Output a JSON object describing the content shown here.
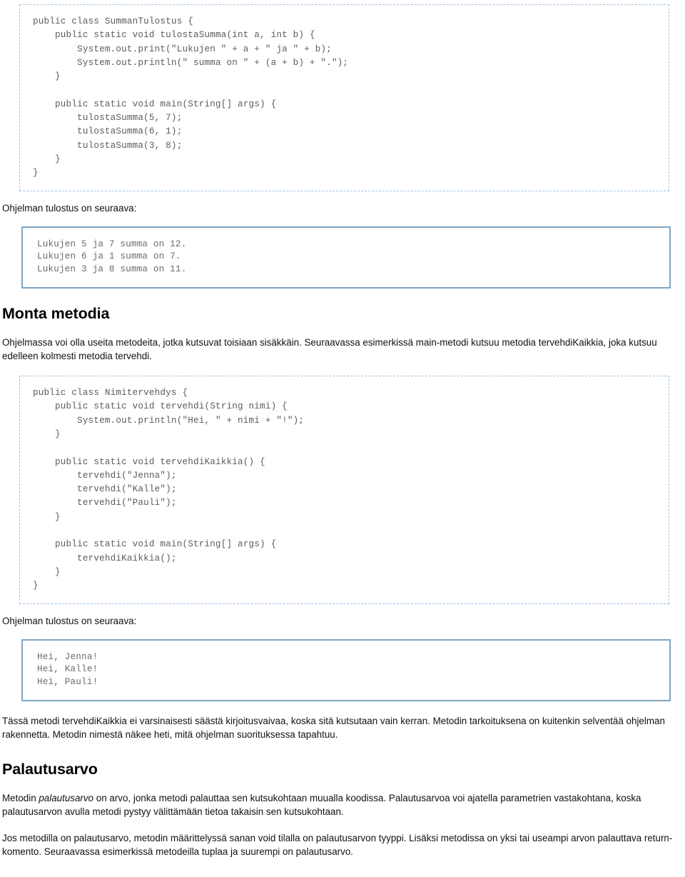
{
  "doc": {
    "language": "fi"
  },
  "blocks": {
    "code_summan_tulostus": {
      "lines": [
        "public class SummanTulostus {",
        "    public static void tulostaSumma(int a, int b) {",
        "        System.out.print(\"Lukujen \" + a + \" ja \" + b);",
        "        System.out.println(\" summa on \" + (a + b) + \".\");",
        "    }",
        "",
        "    public static void main(String[] args) {",
        "        tulostaSumma(5, 7);",
        "        tulostaSumma(6, 1);",
        "        tulostaSumma(3, 8);",
        "    }",
        "}"
      ]
    },
    "output_caption_1": "Ohjelman tulostus on seuraava:",
    "output_summan_tulostus": {
      "lines": [
        "Lukujen 5 ja 7 summa on 12.",
        "Lukujen 6 ja 1 summa on 7.",
        "Lukujen 3 ja 8 summa on 11."
      ]
    },
    "heading_monta_metodia": "Monta metodia",
    "para_monta_metodia": "Ohjelmassa voi olla useita metodeita, jotka kutsuvat toisiaan sisäkkäin. Seuraavassa esimerkissä main-metodi kutsuu metodia tervehdiKaikkia, joka kutsuu edelleen kolmesti metodia tervehdi.",
    "code_nimitervehdys": {
      "lines": [
        "public class Nimitervehdys {",
        "    public static void tervehdi(String nimi) {",
        "        System.out.println(\"Hei, \" + nimi + \"!\");",
        "    }",
        "",
        "    public static void tervehdiKaikkia() {",
        "        tervehdi(\"Jenna\");",
        "        tervehdi(\"Kalle\");",
        "        tervehdi(\"Pauli\");",
        "    }",
        "",
        "    public static void main(String[] args) {",
        "        tervehdiKaikkia();",
        "    }",
        "}"
      ]
    },
    "output_caption_2": "Ohjelman tulostus on seuraava:",
    "output_nimitervehdys": {
      "lines": [
        "Hei, Jenna!",
        "Hei, Kalle!",
        "Hei, Pauli!"
      ]
    },
    "para_tassa_metodi": "Tässä metodi tervehdiKaikkia ei varsinaisesti säästä kirjoitusvaivaa, koska sitä kutsutaan vain kerran. Metodin tarkoituksena on kuitenkin selventää ohjelman rakennetta. Metodin nimestä näkee heti, mitä ohjelman suorituksessa tapahtuu.",
    "heading_palautusarvo": "Palautusarvo",
    "para_palautusarvo_1": {
      "before": "Metodin ",
      "emphasis": "palautusarvo",
      "after": " on arvo, jonka metodi palauttaa sen kutsukohtaan muualla koodissa. Palautusarvoa voi ajatella parametrien vastakohtana, koska palautusarvon avulla metodi pystyy välittämään tietoa takaisin sen kutsukohtaan."
    },
    "para_palautusarvo_2": "Jos metodilla on palautusarvo, metodin määrittelyssä sanan void tilalla on palautusarvon tyyppi. Lisäksi metodissa on yksi tai useampi arvon palauttava return-komento. Seuraavassa esimerkissä metodeilla tuplaa ja suurempi on palautusarvo."
  },
  "colors": {
    "code_border": "#9fc0de",
    "code_text": "#5b5b5b",
    "output_border": "#7fa5c4",
    "output_text": "#6a6a6a",
    "body_text": "#111111"
  }
}
